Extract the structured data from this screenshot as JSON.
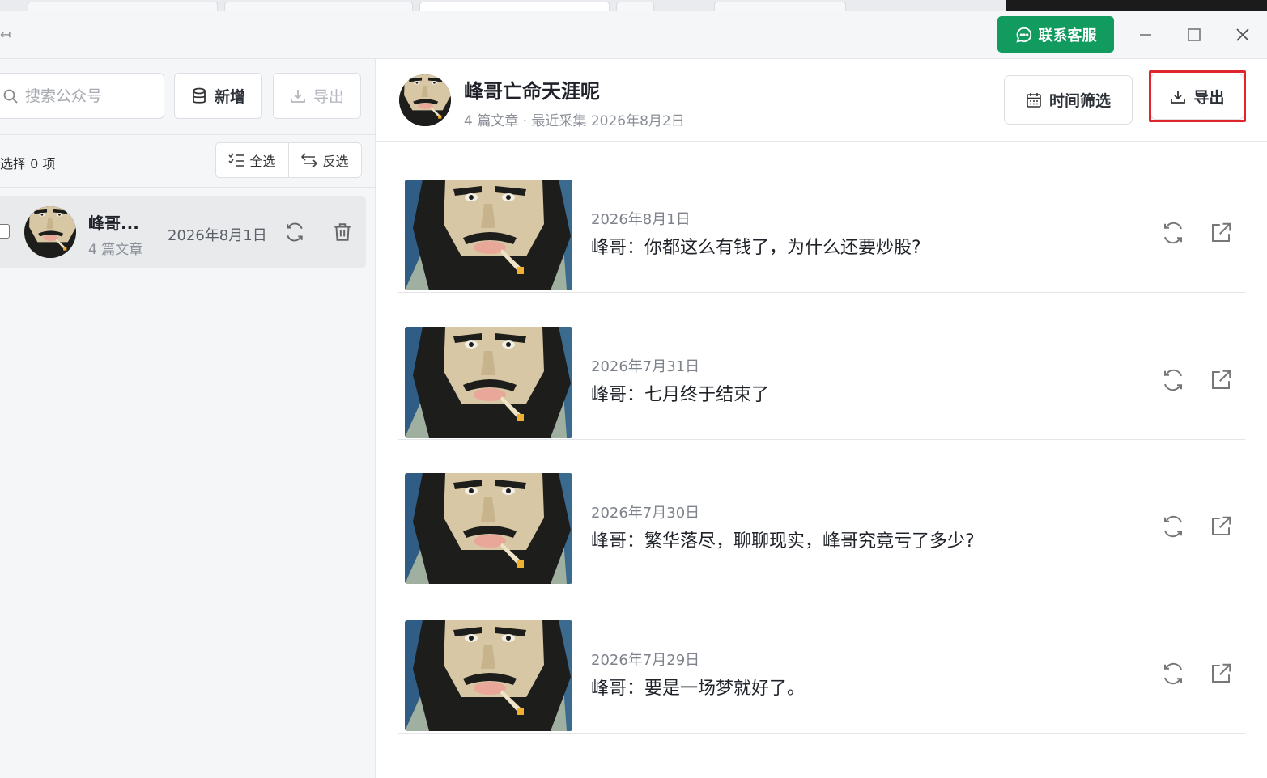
{
  "titlebar": {
    "support_label": "联系客服",
    "support_icon": "chat-bubble-icon",
    "colors": {
      "support_bg": "#129b5f",
      "highlight": "#e0262b"
    }
  },
  "sidebar": {
    "search_placeholder": "搜索公众号",
    "add_label": "新增",
    "export_label": "导出",
    "selected_text": "选择 0 项",
    "select_all_label": "全选",
    "invert_label": "反选",
    "accounts": [
      {
        "name": "峰哥...",
        "article_count": "4 篇文章",
        "date": "2026年8月1日",
        "checked": false
      }
    ]
  },
  "main": {
    "title": "峰哥亡命天涯呢",
    "meta": "4 篇文章 · 最近采集 2026年8月2日",
    "time_filter_label": "时间筛选",
    "export_label": "导出",
    "articles": [
      {
        "date": "2026年8月1日",
        "title": "峰哥：你都这么有钱了，为什么还要炒股?"
      },
      {
        "date": "2026年7月31日",
        "title": "峰哥：七月终于结束了"
      },
      {
        "date": "2026年7月30日",
        "title": "峰哥：繁华落尽，聊聊现实，峰哥究竟亏了多少?"
      },
      {
        "date": "2026年7月29日",
        "title": "峰哥：要是一场梦就好了。"
      }
    ]
  }
}
